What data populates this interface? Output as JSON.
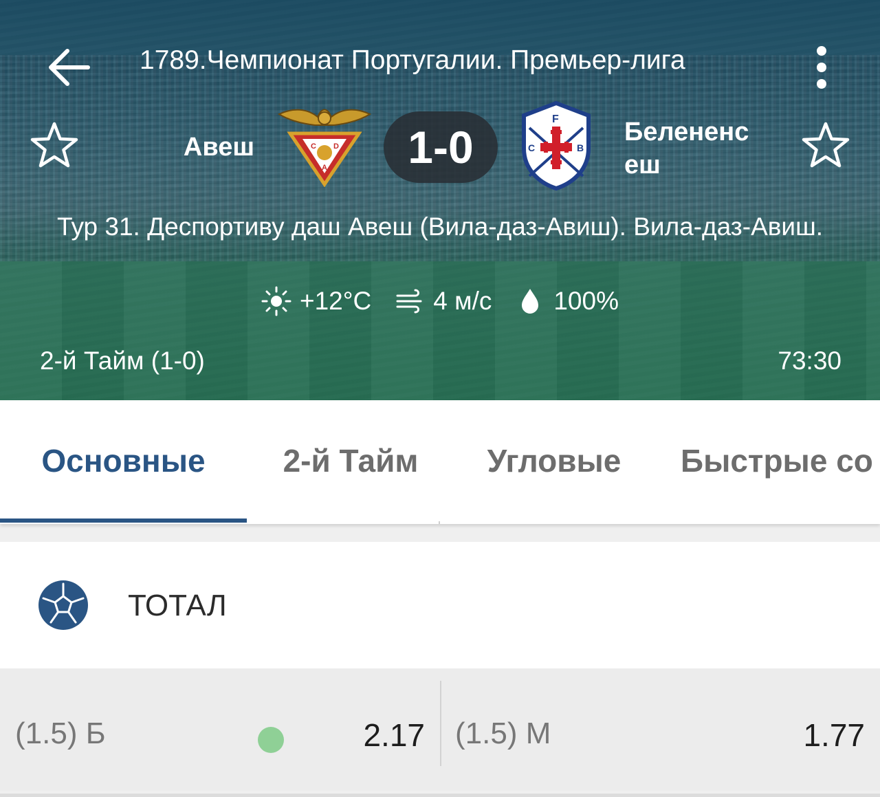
{
  "header": {
    "league_title": "1789.Чемпионат Португалии. Премьер-лига",
    "home_team": "Авеш",
    "away_team": "Белененс еш",
    "score": "1-0",
    "venue": "Тур 31. Деспортиву даш Авеш (Вила-даз-Авиш). Вила-даз-Авиш.",
    "weather": {
      "temperature": "+12°C",
      "wind": "4 м/с",
      "humidity": "100%"
    },
    "period": "2-й  Тайм (1-0)",
    "clock": "73:30",
    "home_logo_letters": [
      "C",
      "D",
      "A"
    ],
    "away_logo_letters": [
      "F",
      "C",
      "B"
    ]
  },
  "tabs": [
    {
      "label": "Основные",
      "active": true
    },
    {
      "label": "2-й  Тайм",
      "active": false
    },
    {
      "label": "Угловые",
      "active": false
    },
    {
      "label": "Быстрые со",
      "active": false
    }
  ],
  "market": {
    "title": "ТОТАЛ",
    "icon": "soccer-ball-icon",
    "outcomes": [
      {
        "label": "(1.5) Б",
        "odds": "2.17",
        "trend": "up"
      },
      {
        "label": "(1.5) М",
        "odds": "1.77"
      }
    ]
  },
  "colors": {
    "accent": "#2a5584",
    "trend_up": "#8fd096",
    "tab_inactive": "#6d6d6d"
  }
}
